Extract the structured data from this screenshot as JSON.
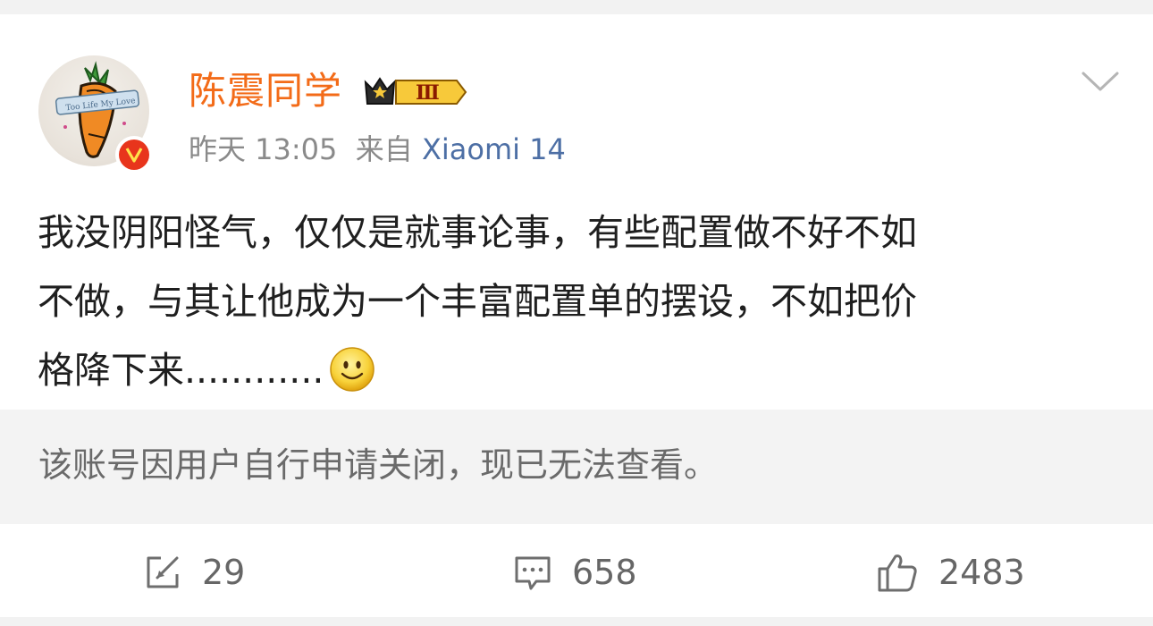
{
  "post": {
    "author": {
      "name": "陈震同学",
      "vip_level": "Ⅲ"
    },
    "meta": {
      "time": "昨天 13:05",
      "source_prefix": "来自",
      "device": "Xiaomi 14"
    },
    "content": {
      "lines": [
        "我没阴阳怪气，仅仅是就事论事，有些配置做不好不如",
        "不做，与其让他成为一个丰富配置单的摆设，不如把价",
        "格降下来............"
      ],
      "emoji": "smile-emoji"
    },
    "notice": {
      "text": "该账号因用户自行申请关闭，现已无法查看。"
    },
    "actions": {
      "repost_count": "29",
      "comment_count": "658",
      "like_count": "2483"
    }
  },
  "colors": {
    "username": "#f36b18",
    "device_link": "#4d6fa5",
    "verified_badge": "#e8351c",
    "notice_bg": "#f3f3f3"
  },
  "icons": [
    "chevron-down-icon",
    "verified-icon",
    "vip-crown-icon",
    "repost-icon",
    "comment-icon",
    "like-icon",
    "smile-emoji"
  ]
}
